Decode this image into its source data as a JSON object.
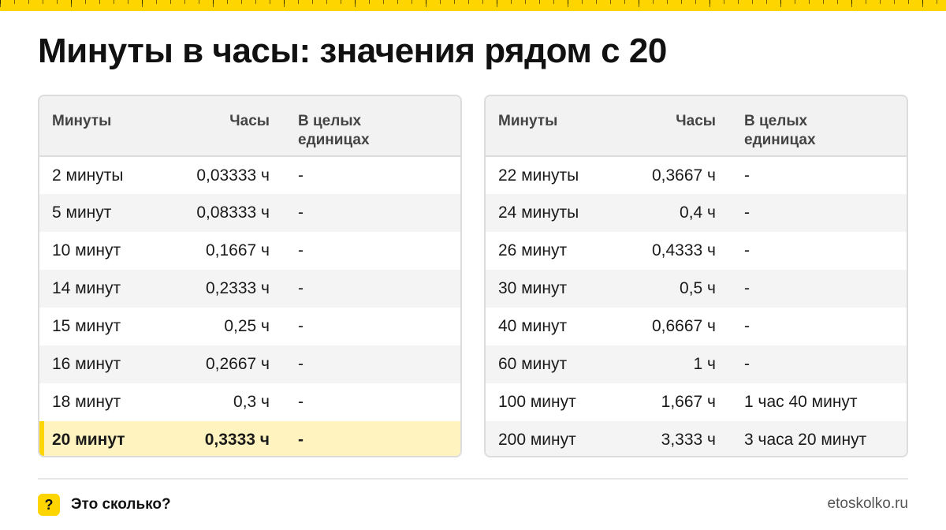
{
  "title": "Минуты в часы: значения рядом с 20",
  "colors": {
    "accent": "#FFD500",
    "highlight_row": "#FFF4BF"
  },
  "columns": [
    "Минуты",
    "Часы",
    "В целых единицах"
  ],
  "left_table": [
    {
      "minutes": "2 минуты",
      "hours": "0,03333 ч",
      "units": "-"
    },
    {
      "minutes": "5 минут",
      "hours": "0,08333 ч",
      "units": "-"
    },
    {
      "minutes": "10 минут",
      "hours": "0,1667 ч",
      "units": "-"
    },
    {
      "minutes": "14 минут",
      "hours": "0,2333 ч",
      "units": "-"
    },
    {
      "minutes": "15 минут",
      "hours": "0,25 ч",
      "units": "-"
    },
    {
      "minutes": "16 минут",
      "hours": "0,2667 ч",
      "units": "-"
    },
    {
      "minutes": "18 минут",
      "hours": "0,3 ч",
      "units": "-"
    },
    {
      "minutes": "20 минут",
      "hours": "0,3333 ч",
      "units": "-"
    }
  ],
  "right_table": [
    {
      "minutes": "22 минуты",
      "hours": "0,3667 ч",
      "units": "-"
    },
    {
      "minutes": "24 минуты",
      "hours": "0,4 ч",
      "units": "-"
    },
    {
      "minutes": "26 минут",
      "hours": "0,4333 ч",
      "units": "-"
    },
    {
      "minutes": "30 минут",
      "hours": "0,5 ч",
      "units": "-"
    },
    {
      "minutes": "40 минут",
      "hours": "0,6667 ч",
      "units": "-"
    },
    {
      "minutes": "60 минут",
      "hours": "1 ч",
      "units": "-"
    },
    {
      "minutes": "100 минут",
      "hours": "1,667 ч",
      "units": "1 час 40 минут"
    },
    {
      "minutes": "200 минут",
      "hours": "3,333 ч",
      "units": "3 часа 20 минут"
    }
  ],
  "footer": {
    "icon": "question-mark-icon",
    "icon_glyph": "?",
    "brand": "Это сколько?",
    "site": "etoskolko.ru"
  }
}
